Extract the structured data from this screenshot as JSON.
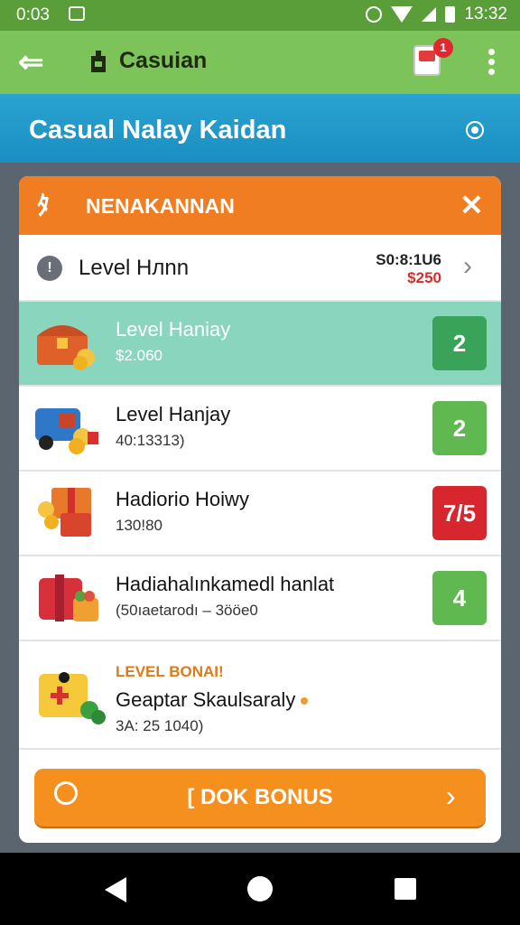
{
  "status_bar": {
    "time": "0:03",
    "clock": "13:32"
  },
  "app_bar": {
    "title": "Casuian",
    "notification_count": "1"
  },
  "banner": {
    "title": "Casual Nalay Kaidan"
  },
  "dialog": {
    "header": "NENAKANNAN",
    "level_row": {
      "label": "Level Hлnn",
      "value_primary": "S0:8:1U6",
      "value_secondary": "$250"
    },
    "items": [
      {
        "name": "Level Haniay",
        "sub": "$2.060",
        "badge": "2",
        "badge_color": "#3aa35a",
        "row_bg": "#8ad5be"
      },
      {
        "name": "Level Hanjay",
        "sub": "40:13313)",
        "badge": "2",
        "badge_color": "#5fb850",
        "row_bg": "#ffffff"
      },
      {
        "name": "Hadiorio Hoiwy",
        "sub": "130!80",
        "badge": "7/5",
        "badge_color": "#d8262f",
        "row_bg": "#ffffff"
      },
      {
        "name": "Hadiahalınkamedl hanlat",
        "sub": "(50ıaetarodı – 3ööe0",
        "badge": "4",
        "badge_color": "#5fb850",
        "row_bg": "#ffffff"
      }
    ],
    "bonus": {
      "kicker": "LEVEL BONAI!",
      "name": "Geaptar Skaulsaraly",
      "sub": "3A: 25 1040)"
    },
    "cta": {
      "label": "[ DOK BONUS"
    }
  },
  "icons": [
    "back-arrow-icon",
    "app-logo-icon",
    "notification-icon",
    "more-vert-icon",
    "banner-info-icon",
    "close-icon",
    "info-icon",
    "chevron-right-icon",
    "treasure-chest-icon",
    "truck-coins-icon",
    "gift-box-icon",
    "gift-basket-icon",
    "bonus-box-icon",
    "chat-bubble-icon"
  ]
}
